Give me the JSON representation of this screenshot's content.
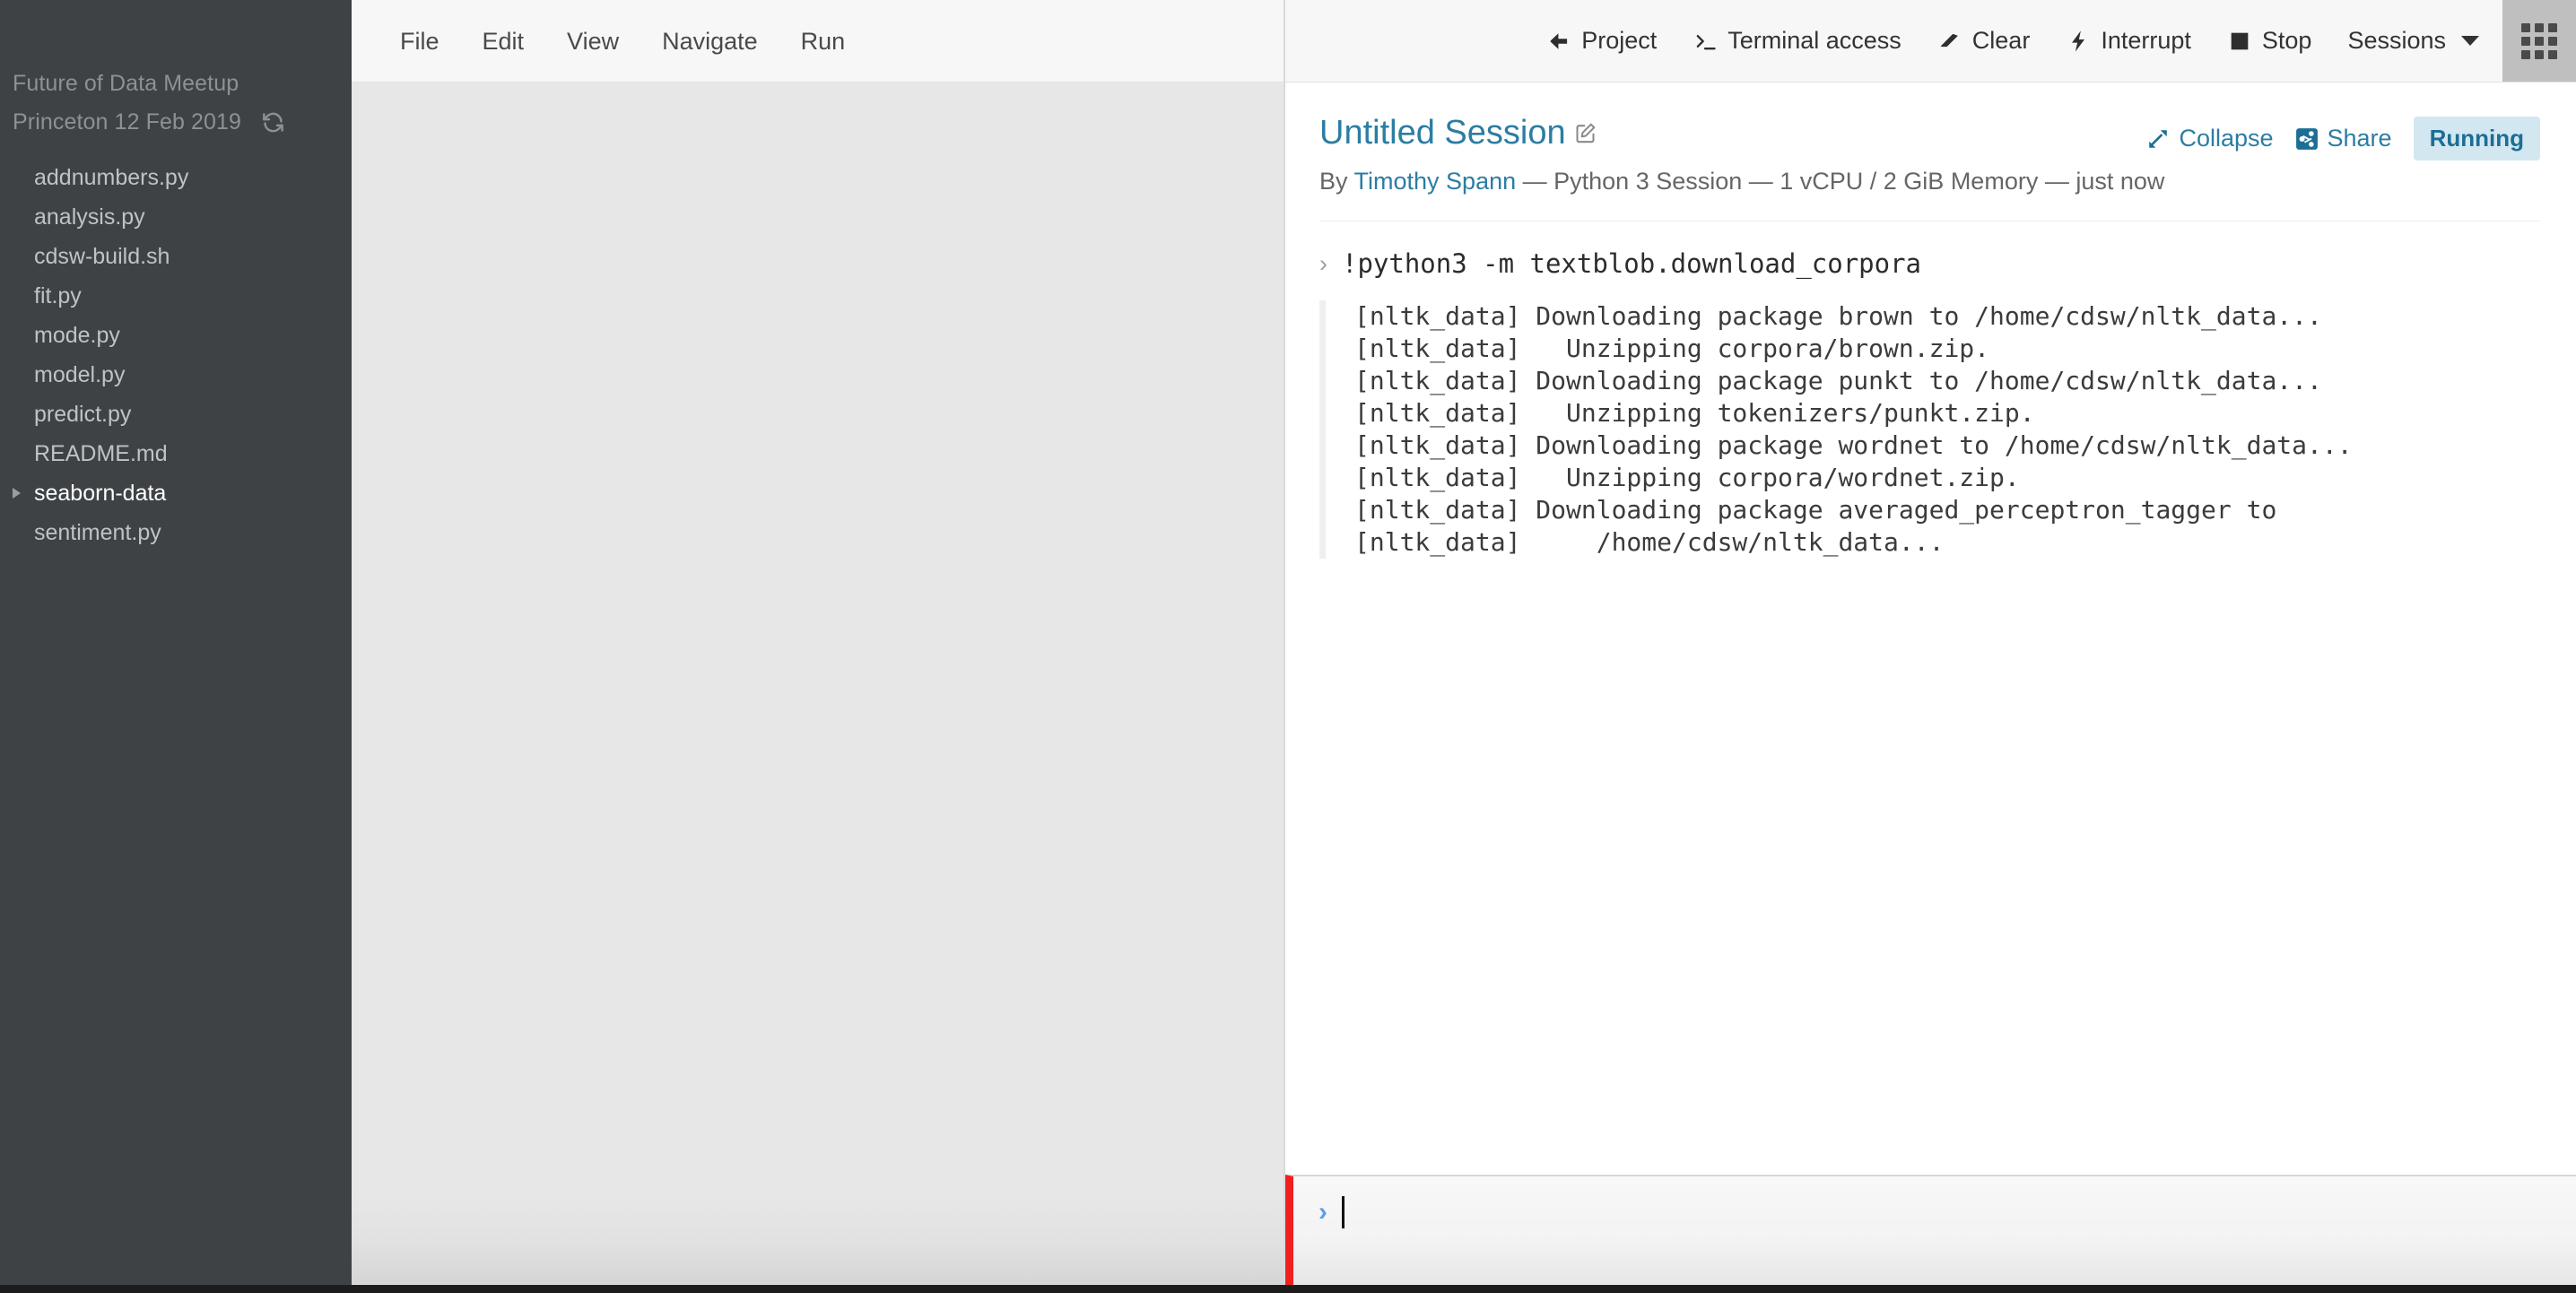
{
  "sidebar": {
    "project_title_line1": "Future of Data Meetup",
    "project_title_line2": "Princeton 12 Feb 2019",
    "refresh_icon": "refresh-icon",
    "files": [
      {
        "name": "addnumbers.py",
        "type": "file"
      },
      {
        "name": "analysis.py",
        "type": "file"
      },
      {
        "name": "cdsw-build.sh",
        "type": "file"
      },
      {
        "name": "fit.py",
        "type": "file"
      },
      {
        "name": "mode.py",
        "type": "file"
      },
      {
        "name": "model.py",
        "type": "file"
      },
      {
        "name": "predict.py",
        "type": "file"
      },
      {
        "name": "README.md",
        "type": "file"
      },
      {
        "name": "seaborn-data",
        "type": "folder"
      },
      {
        "name": "sentiment.py",
        "type": "file"
      }
    ]
  },
  "menubar": {
    "items": [
      {
        "label": "File"
      },
      {
        "label": "Edit"
      },
      {
        "label": "View"
      },
      {
        "label": "Navigate"
      },
      {
        "label": "Run"
      }
    ]
  },
  "toolbar": {
    "project_label": "Project",
    "project_icon": "arrow-left-icon",
    "terminal_label": "Terminal access",
    "terminal_icon": "terminal-prompt-icon",
    "clear_label": "Clear",
    "clear_icon": "eraser-icon",
    "interrupt_label": "Interrupt",
    "interrupt_icon": "lightning-bolt-icon",
    "stop_label": "Stop",
    "stop_icon": "stop-square-icon",
    "sessions_label": "Sessions",
    "sessions_caret_icon": "chevron-down-icon",
    "apps_icon": "grid-apps-icon"
  },
  "session": {
    "title": "Untitled Session",
    "edit_icon": "edit-pencil-icon",
    "by_prefix": "By ",
    "author": "Timothy Spann",
    "meta_suffix": " — Python 3 Session — 1 vCPU / 2 GiB Memory — just now",
    "collapse_label": "Collapse",
    "collapse_icon": "collapse-arrows-icon",
    "share_label": "Share",
    "share_icon": "share-nodes-icon",
    "status": "Running",
    "status_color": "#d3e7f1",
    "status_text_color": "#1c6e94",
    "accent_color": "#2b7da3"
  },
  "console": {
    "prompt_chevron": "›",
    "command": "!python3 -m textblob.download_corpora",
    "output_lines": [
      "[nltk_data] Downloading package brown to /home/cdsw/nltk_data...",
      "[nltk_data]   Unzipping corpora/brown.zip.",
      "[nltk_data] Downloading package punkt to /home/cdsw/nltk_data...",
      "[nltk_data]   Unzipping tokenizers/punkt.zip.",
      "[nltk_data] Downloading package wordnet to /home/cdsw/nltk_data...",
      "[nltk_data]   Unzipping corpora/wordnet.zip.",
      "[nltk_data] Downloading package averaged_perceptron_tagger to",
      "[nltk_data]     /home/cdsw/nltk_data..."
    ]
  },
  "prompt": {
    "chevron": "›",
    "value": "",
    "placeholder": "",
    "accent_bar_color": "#f02020"
  }
}
